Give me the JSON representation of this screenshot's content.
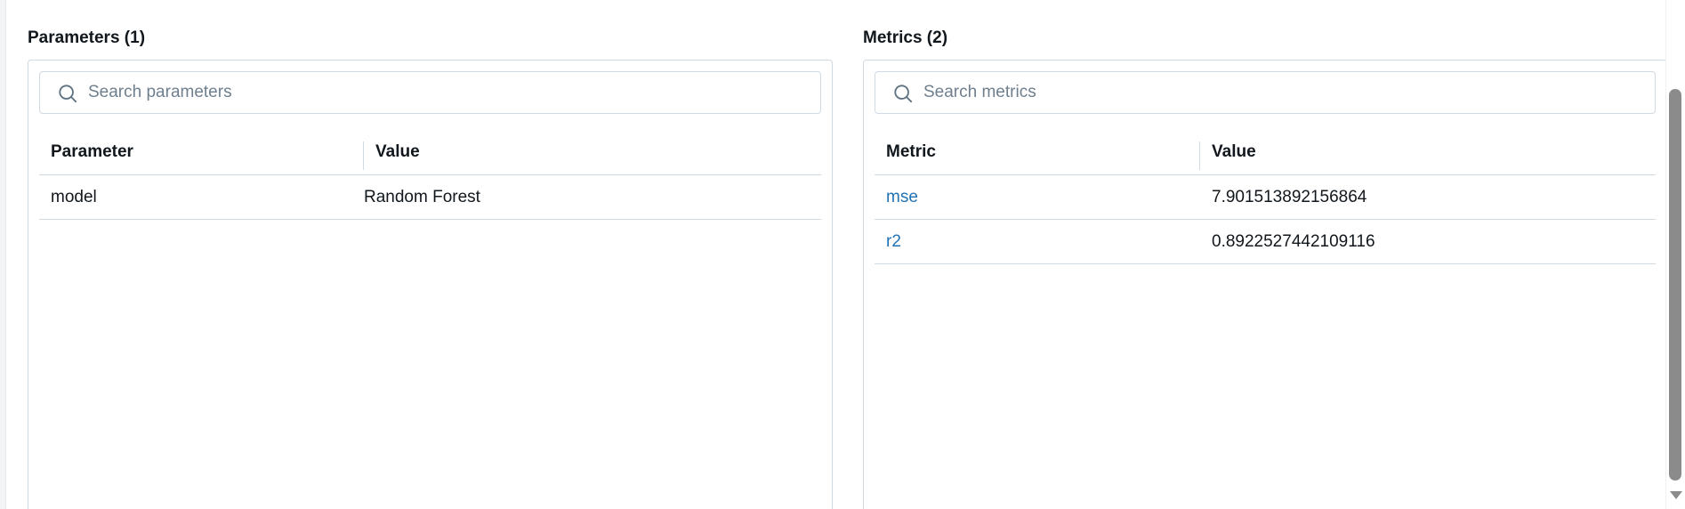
{
  "parameters": {
    "title": "Parameters (1)",
    "search_placeholder": "Search parameters",
    "columns": [
      "Parameter",
      "Value"
    ],
    "rows": [
      {
        "name": "model",
        "value": "Random Forest"
      }
    ]
  },
  "metrics": {
    "title": "Metrics (2)",
    "search_placeholder": "Search metrics",
    "columns": [
      "Metric",
      "Value"
    ],
    "rows": [
      {
        "name": "mse",
        "value": "7.901513892156864"
      },
      {
        "name": "r2",
        "value": "0.8922527442109116"
      }
    ]
  },
  "icons": {
    "search": "search-icon",
    "scroll_down": "chevron-down-icon"
  },
  "colors": {
    "link": "#2272b4",
    "border": "#d1d9e1",
    "placeholder": "#6f7f8e",
    "text": "#11171c"
  }
}
